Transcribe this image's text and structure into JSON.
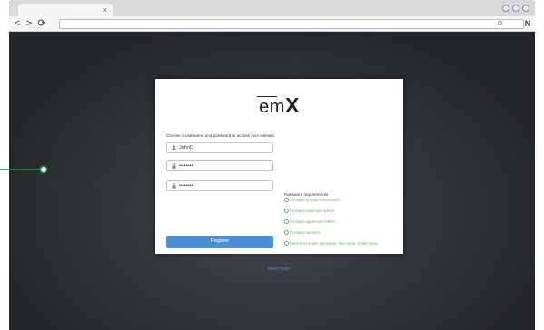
{
  "browser": {
    "tab_close": "×",
    "nav_back": "<",
    "nav_forward": ">",
    "nav_reload": "⟳",
    "url_icon": "⊜",
    "extension_icon": "N"
  },
  "form": {
    "logo_text": "em",
    "logo_accent": "X",
    "instruction": "Choose a username and password to access your website.",
    "username": {
      "icon": "person-icon",
      "value": "JohnD"
    },
    "password": {
      "icon": "lock-icon",
      "value": "••••••••"
    },
    "confirm_password": {
      "icon": "lock-icon",
      "value": "••••••••"
    },
    "register_label": "Register",
    "help_link": "Need help?"
  },
  "requirements": {
    "title": "Password requirements",
    "items": [
      "Contains at least 8 characters",
      "Contains lowercase letters",
      "Contains uppercase letters",
      "Contains numbers",
      "Does not contain username, first name, or last name"
    ]
  },
  "colors": {
    "accent": "#4a90d9",
    "success": "#5cb85c",
    "pointer": "#2d8a4e"
  }
}
